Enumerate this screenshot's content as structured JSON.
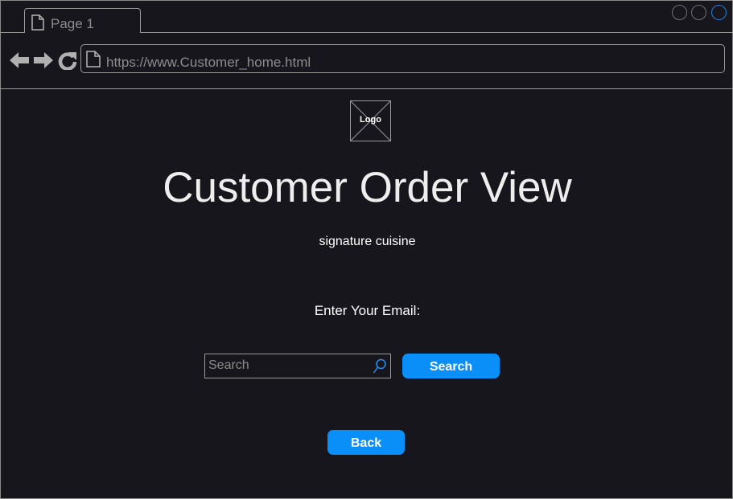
{
  "browser": {
    "tab_label": "Page 1",
    "url": "https://www.Customer_home.html"
  },
  "page": {
    "logo_label": "Logo",
    "title": "Customer Order View",
    "subtitle": "signature cuisine",
    "email_label": "Enter Your Email:",
    "search": {
      "placeholder": "Search",
      "value": ""
    },
    "search_button": "Search",
    "back_button": "Back"
  },
  "colors": {
    "background": "#18161d",
    "accent": "#0a8ff8",
    "active_window_button": "#2a7ad6"
  },
  "icons": {
    "tab": "document-icon",
    "nav": [
      "back-arrow-icon",
      "forward-arrow-icon",
      "reload-icon"
    ],
    "url": "document-icon",
    "search": "search-icon",
    "logo": "image-placeholder-icon"
  }
}
